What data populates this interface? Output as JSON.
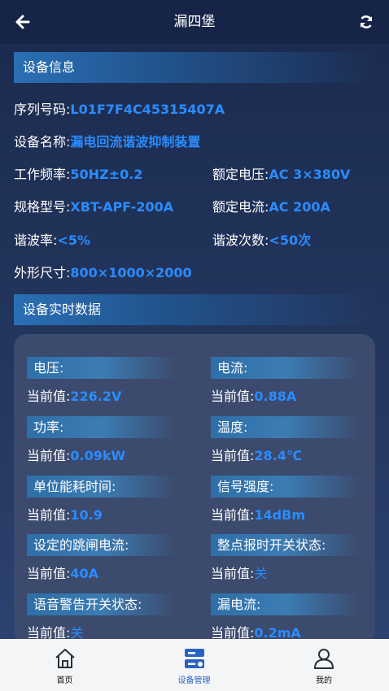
{
  "header": {
    "title": "漏四堡"
  },
  "sections": {
    "device_info": "设备信息",
    "realtime": "设备实时数据"
  },
  "info": {
    "serial": {
      "label": "序列号码:",
      "value": "L01F7F4C45315407A"
    },
    "name": {
      "label": "设备名称:",
      "value": "漏电回流谐波抑制装置"
    },
    "freq": {
      "label": "工作频率:",
      "value": "50HZ±0.2"
    },
    "rated_voltage": {
      "label": "额定电压:",
      "value": "AC 3×380V"
    },
    "model": {
      "label": "规格型号:",
      "value": "XBT-APF-200A"
    },
    "rated_current": {
      "label": "额定电流:",
      "value": "AC 200A"
    },
    "harmonic_rate": {
      "label": "谐波率:",
      "value": "<5%"
    },
    "harmonic_order": {
      "label": "谐波次数:",
      "value": "<50次"
    },
    "size": {
      "label": "外形尺寸:",
      "value": "800×1000×2000"
    }
  },
  "current_label": "当前值:",
  "tiles": [
    {
      "label": "电压:",
      "value": "226.2V"
    },
    {
      "label": "电流:",
      "value": "0.88A"
    },
    {
      "label": "功率:",
      "value": "0.09kW"
    },
    {
      "label": "温度:",
      "value": "28.4℃"
    },
    {
      "label": "单位能耗时间:",
      "value": "10.9"
    },
    {
      "label": "信号强度:",
      "value": "14dBm"
    },
    {
      "label": "设定的跳闸电流:",
      "value": "40A"
    },
    {
      "label": "整点报时开关状态:",
      "value": "关"
    },
    {
      "label": "语音警告开关状态:",
      "value": "关"
    },
    {
      "label": "漏电流:",
      "value": "0.2mA"
    }
  ],
  "tabs": [
    {
      "label": "首页",
      "icon": "home-icon"
    },
    {
      "label": "设备管理",
      "icon": "device-management-icon"
    },
    {
      "label": "我的",
      "icon": "user-icon"
    }
  ],
  "colors": {
    "accent": "#2a8cff",
    "tab_active": "#2b62c2"
  }
}
